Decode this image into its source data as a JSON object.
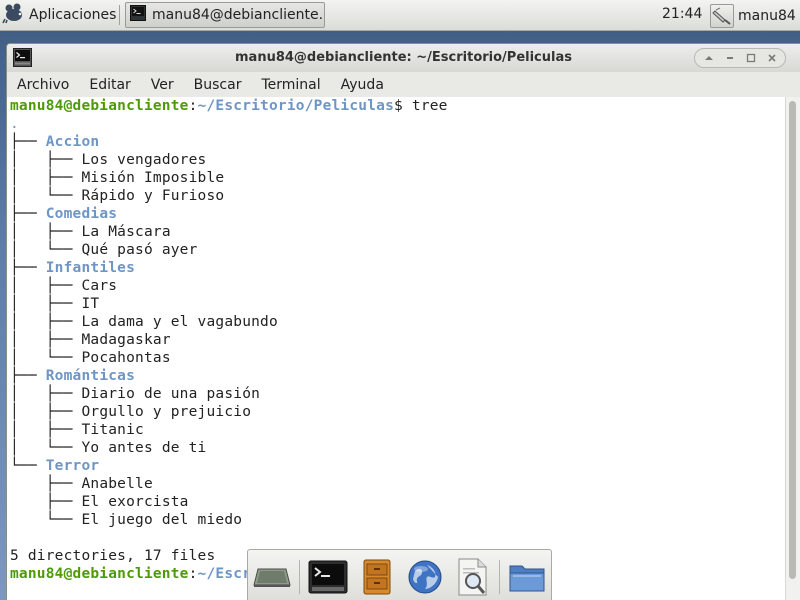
{
  "panel": {
    "apps_menu_label": "Aplicaciones",
    "task_label": "manu84@debiancliente...",
    "clock": "21:44",
    "user": "manu84"
  },
  "window": {
    "title": "manu84@debiancliente: ~/Escritorio/Peliculas",
    "controls": [
      "up-arrow",
      "minimize",
      "maximize",
      "close"
    ]
  },
  "menubar": [
    "Archivo",
    "Editar",
    "Ver",
    "Buscar",
    "Terminal",
    "Ayuda"
  ],
  "terminal": {
    "prompt_user": "manu84@debiancliente",
    "prompt_sep": ":",
    "prompt_path": "~/Escritorio/Peliculas",
    "prompt_symbol": "$",
    "command": " tree",
    "root": ".",
    "tree": [
      {
        "dir": "Accion",
        "files": [
          "Los vengadores",
          "Misión Imposible",
          "Rápido y Furioso"
        ]
      },
      {
        "dir": "Comedias",
        "files": [
          "La Máscara",
          "Qué pasó ayer"
        ]
      },
      {
        "dir": "Infantiles",
        "files": [
          "Cars",
          "IT",
          "La dama y el vagabundo",
          "Madagaskar",
          "Pocahontas"
        ]
      },
      {
        "dir": "Románticas",
        "files": [
          "Diario de una pasión",
          "Orgullo y prejuicio",
          "Titanic",
          "Yo antes de ti"
        ]
      },
      {
        "dir": "Terror",
        "files": [
          "Anabelle",
          "El exorcista",
          "El juego del miedo"
        ]
      }
    ],
    "summary": "5 directories, 17 files",
    "last_prompt_user": "manu84@debiancliente",
    "last_prompt_sep": ":",
    "last_prompt_path": "~/Escr"
  },
  "dock": {
    "items": [
      "show-desktop-icon",
      "terminal-icon",
      "file-manager-icon",
      "web-browser-icon",
      "app-finder-icon",
      "folder-icon"
    ]
  },
  "colors": {
    "prompt_user": "#4e9a06",
    "directory": "#6f95c5"
  }
}
